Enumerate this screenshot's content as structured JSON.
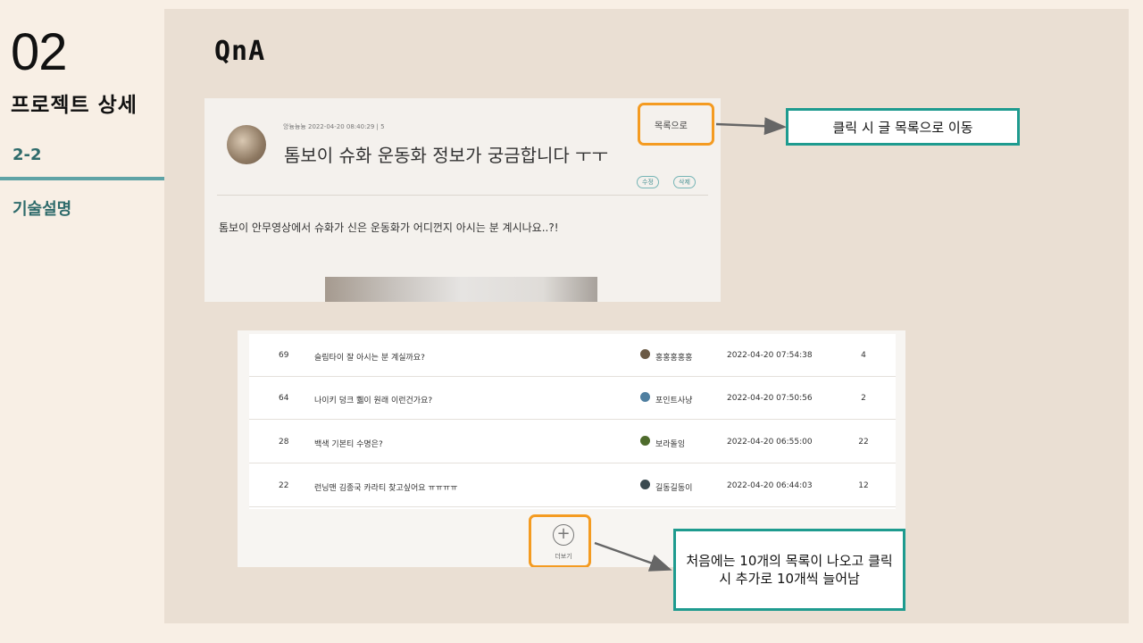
{
  "sidebar": {
    "section_number": "02",
    "section_title": "프로젝트 상세",
    "sub_number": "2-2",
    "sub_title": "기술설명"
  },
  "page_title": "QnA",
  "post_detail": {
    "meta": "앙늉늉늉 2022-04-20 08:40:29 | 5",
    "title": "톰보이 슈화 운동화 정보가 궁금합니다 ㅜㅜ",
    "edit_label": "수정",
    "delete_label": "삭제",
    "body": "톰보이 안무영상에서 슈화가 신은 운동화가 어디껀지 아시는 분 계시나요..?!",
    "list_link": "목록으로"
  },
  "callouts": {
    "list_link_note": "클릭 시 글 목록으로 이동",
    "more_note": "처음에는 10개의 목록이 나오고 클릭 시 추가로 10개씩 늘어남"
  },
  "post_list": {
    "rows": [
      {
        "num": "69",
        "title": "슬림타이 잘 아시는 분 계실까요?",
        "author": "홍홍홍홍홍",
        "date": "2022-04-20 07:54:38",
        "count": "4",
        "avatar_color": "#6b5a45"
      },
      {
        "num": "64",
        "title": "나이키 덩크 쀏이 원래 이런건가요?",
        "author": "포인트사냥",
        "date": "2022-04-20 07:50:56",
        "count": "2",
        "avatar_color": "#4f7fa0"
      },
      {
        "num": "28",
        "title": "백색 기본티 수명은?",
        "author": "보라돌잉",
        "date": "2022-04-20 06:55:00",
        "count": "22",
        "avatar_color": "#4e6b2c"
      },
      {
        "num": "22",
        "title": "런닝맨 김종국 카라티 찾고싶어요 ㅠㅠㅠㅠ",
        "author": "길동길동이",
        "date": "2022-04-20 06:44:03",
        "count": "12",
        "avatar_color": "#3a4a50"
      }
    ],
    "more_label": "더보기"
  }
}
